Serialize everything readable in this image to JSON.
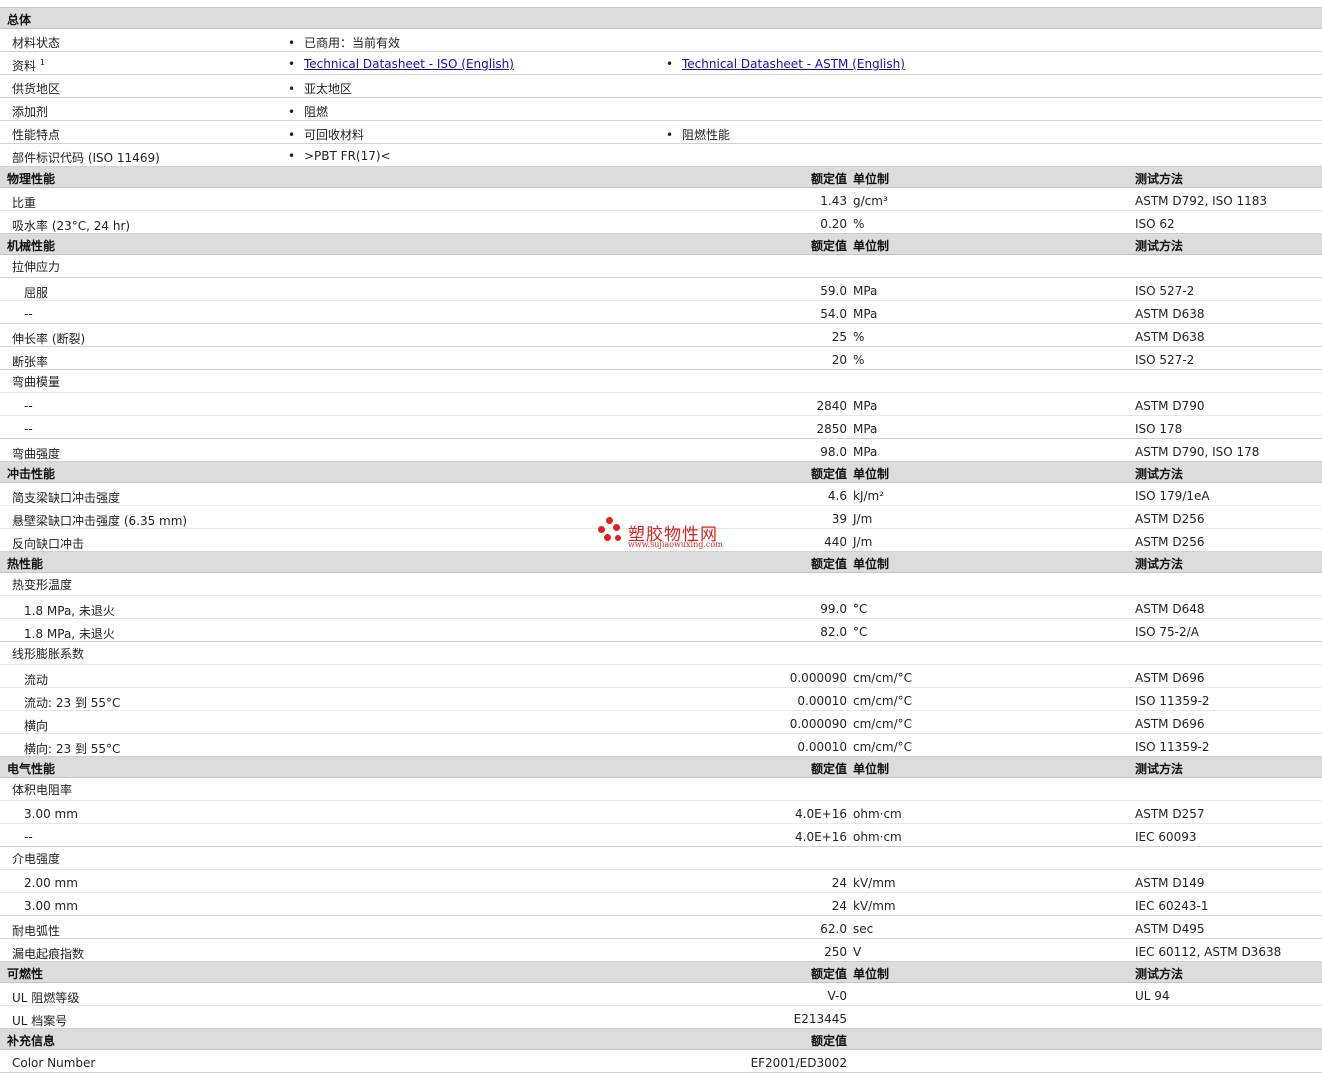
{
  "general": {
    "header": "总体",
    "rows": [
      {
        "label": "材料状态",
        "items": [
          {
            "text": "已商用：当前有效"
          }
        ]
      },
      {
        "label": "资料",
        "sup": "1",
        "items": [
          {
            "text": "Technical Datasheet - ISO (English)",
            "link": true
          },
          {
            "text": "Technical Datasheet - ASTM (English)",
            "link": true
          }
        ]
      },
      {
        "label": "供货地区",
        "items": [
          {
            "text": "亚太地区"
          }
        ]
      },
      {
        "label": "添加剂",
        "items": [
          {
            "text": "阻燃"
          }
        ]
      },
      {
        "label": "性能特点",
        "items": [
          {
            "text": "可回收材料"
          },
          {
            "text": "阻燃性能"
          }
        ]
      },
      {
        "label": "部件标识代码 (ISO 11469)",
        "items": [
          {
            "text": ">PBT FR(17)<"
          }
        ]
      }
    ]
  },
  "sections": [
    {
      "title": "物理性能",
      "col_value": "额定值",
      "col_unit": "单位制",
      "col_test": "测试方法",
      "rows": [
        {
          "label": "比重",
          "value": "1.43",
          "unit": "g/cm³",
          "test": "ASTM D792, ISO 1183"
        },
        {
          "label": "吸水率 (23°C, 24 hr)",
          "value": "0.20",
          "unit": "%",
          "test": "ISO 62"
        }
      ]
    },
    {
      "title": "机械性能",
      "col_value": "额定值",
      "col_unit": "单位制",
      "col_test": "测试方法",
      "rows": [
        {
          "label": "拉伸应力"
        },
        {
          "label": "屈服",
          "sub": true,
          "value": "59.0",
          "unit": "MPa",
          "test": "ISO 527-2"
        },
        {
          "label": "--",
          "sub": true,
          "value": "54.0",
          "unit": "MPa",
          "test": "ASTM D638"
        },
        {
          "label": "伸长率 (断裂)",
          "value": "25",
          "unit": "%",
          "test": "ASTM D638"
        },
        {
          "label": "断张率",
          "value": "20",
          "unit": "%",
          "test": "ISO 527-2"
        },
        {
          "label": "弯曲模量"
        },
        {
          "label": "--",
          "sub": true,
          "value": "2840",
          "unit": "MPa",
          "test": "ASTM D790"
        },
        {
          "label": "--",
          "sub": true,
          "value": "2850",
          "unit": "MPa",
          "test": "ISO 178"
        },
        {
          "label": "弯曲强度",
          "value": "98.0",
          "unit": "MPa",
          "test": "ASTM D790, ISO 178"
        }
      ]
    },
    {
      "title": "冲击性能",
      "col_value": "额定值",
      "col_unit": "单位制",
      "col_test": "测试方法",
      "rows": [
        {
          "label": "简支梁缺口冲击强度",
          "value": "4.6",
          "unit": "kJ/m²",
          "test": "ISO 179/1eA"
        },
        {
          "label": "悬壁梁缺口冲击强度 (6.35 mm)",
          "value": "39",
          "unit": "J/m",
          "test": "ASTM D256"
        },
        {
          "label": "反向缺口冲击",
          "value": "440",
          "unit": "J/m",
          "test": "ASTM D256"
        }
      ]
    },
    {
      "title": "热性能",
      "col_value": "额定值",
      "col_unit": "单位制",
      "col_test": "测试方法",
      "rows": [
        {
          "label": "热变形温度"
        },
        {
          "label": "1.8 MPa, 未退火",
          "sub": true,
          "value": "99.0",
          "unit": "°C",
          "test": "ASTM D648"
        },
        {
          "label": "1.8 MPa, 未退火",
          "sub": true,
          "value": "82.0",
          "unit": "°C",
          "test": "ISO 75-2/A"
        },
        {
          "label": "线形膨胀系数"
        },
        {
          "label": "流动",
          "sub": true,
          "value": "0.000090",
          "unit": "cm/cm/°C",
          "test": "ASTM D696"
        },
        {
          "label": "流动: 23 到 55°C",
          "sub": true,
          "value": "0.00010",
          "unit": "cm/cm/°C",
          "test": "ISO 11359-2"
        },
        {
          "label": "横向",
          "sub": true,
          "value": "0.000090",
          "unit": "cm/cm/°C",
          "test": "ASTM D696"
        },
        {
          "label": "横向: 23 到 55°C",
          "sub": true,
          "value": "0.00010",
          "unit": "cm/cm/°C",
          "test": "ISO 11359-2"
        }
      ]
    },
    {
      "title": "电气性能",
      "col_value": "额定值",
      "col_unit": "单位制",
      "col_test": "测试方法",
      "rows": [
        {
          "label": "体积电阻率"
        },
        {
          "label": "3.00 mm",
          "sub": true,
          "value": "4.0E+16",
          "unit": "ohm·cm",
          "test": "ASTM D257"
        },
        {
          "label": "--",
          "sub": true,
          "value": "4.0E+16",
          "unit": "ohm·cm",
          "test": "IEC 60093"
        },
        {
          "label": "介电强度"
        },
        {
          "label": "2.00 mm",
          "sub": true,
          "value": "24",
          "unit": "kV/mm",
          "test": "ASTM D149"
        },
        {
          "label": "3.00 mm",
          "sub": true,
          "value": "24",
          "unit": "kV/mm",
          "test": "IEC 60243-1"
        },
        {
          "label": "耐电弧性",
          "value": "62.0",
          "unit": "sec",
          "test": "ASTM D495"
        },
        {
          "label": "漏电起痕指数",
          "value": "250",
          "unit": "V",
          "test": "IEC 60112, ASTM D3638"
        }
      ]
    },
    {
      "title": "可燃性",
      "col_value": "额定值",
      "col_unit": "单位制",
      "col_test": "测试方法",
      "rows": [
        {
          "label": "UL 阻燃等级",
          "value": "V-0",
          "test": "UL 94"
        },
        {
          "label": "UL 档案号",
          "value": "E213445"
        }
      ]
    },
    {
      "title": "补充信息",
      "col_value": "额定值",
      "rows": [
        {
          "label": "Color Number",
          "value": "EF2001/ED3002"
        }
      ]
    }
  ],
  "watermark": {
    "text": "塑胶物性网",
    "url": "www.sujiaowuxing.com",
    "color": "#e02020"
  }
}
